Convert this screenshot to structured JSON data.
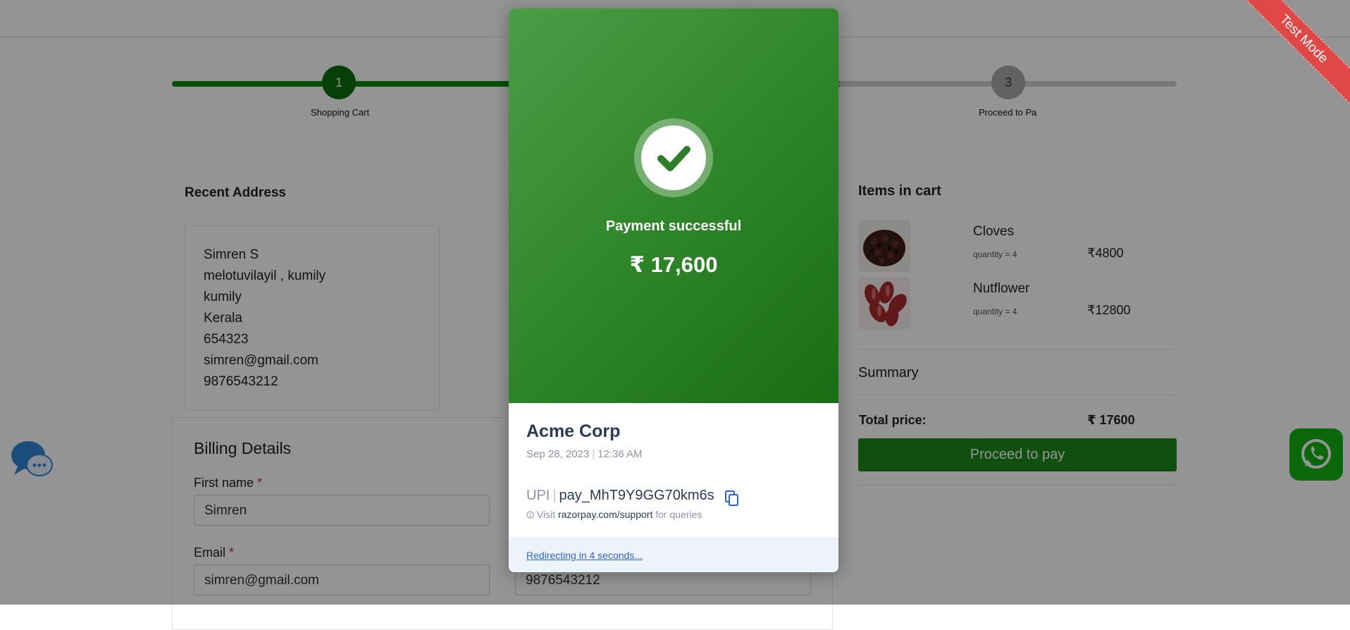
{
  "stepper": {
    "steps": [
      {
        "number": "1",
        "label": "Shopping Cart"
      },
      {
        "number": "3",
        "label": "Proceed to Pa"
      }
    ]
  },
  "address": {
    "heading": "Recent Address",
    "lines": [
      "Simren S",
      "melotuvilayil , kumily",
      "kumily",
      "Kerala",
      "654323",
      "simren@gmail.com",
      "9876543212"
    ]
  },
  "billing": {
    "title": "Billing Details",
    "first_name_label": "First name",
    "first_name_value": "Simren",
    "email_label": "Email",
    "email_value": "simren@gmail.com",
    "phone_value": "9876543212",
    "required_mark": "*"
  },
  "cart": {
    "heading": "Items in cart",
    "items": [
      {
        "name": "Cloves",
        "qty": "quantity = 4",
        "price": "₹4800"
      },
      {
        "name": "Nutflower",
        "qty": "quantity = 4",
        "price": "₹12800"
      }
    ],
    "summary_label": "Summary",
    "total_label": "Total price:",
    "total_value": "₹ 17600",
    "proceed_label": "Proceed to pay"
  },
  "ribbon": {
    "label": "Test Mode"
  },
  "modal": {
    "status": "Payment successful",
    "amount": "₹ 17,600",
    "merchant": "Acme Corp",
    "date": "Sep 28, 2023",
    "time": "12:36 AM",
    "method": "UPI",
    "payment_id": "pay_MhT9Y9GG70km6s",
    "visit_prefix": "Visit",
    "support_link": "razorpay.com/support",
    "visit_suffix": "for queries",
    "redirect": "Redirecting in 4 seconds..."
  },
  "colors": {
    "brand_green": "#1b8a1b",
    "modal_gradient_start": "#4c9d46",
    "modal_gradient_end": "#196d14",
    "ribbon": "#e04848",
    "whatsapp": "#12b312"
  },
  "icons": [
    "check-icon",
    "copy-icon",
    "info-icon",
    "chat-bubble-icon",
    "whatsapp-icon"
  ]
}
